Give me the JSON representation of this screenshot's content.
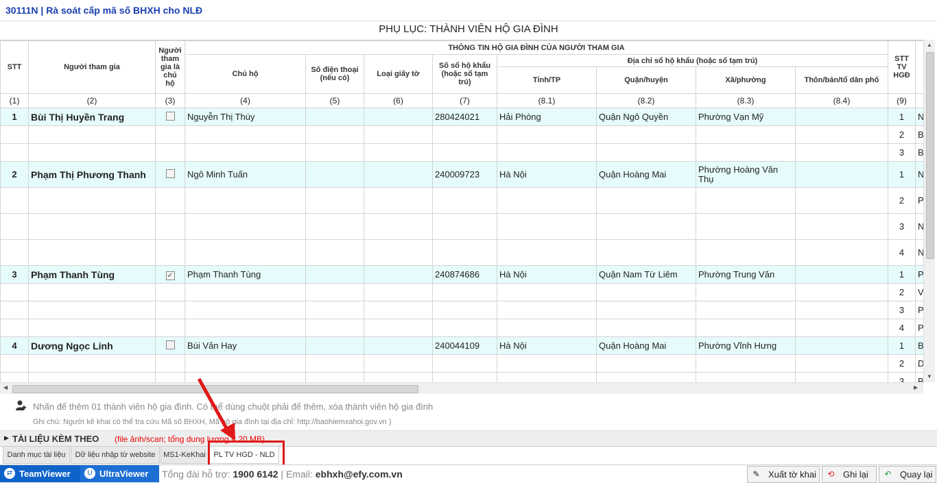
{
  "app_title": "30111N | Rà soát cấp mã số BHXH cho NLĐ",
  "annex_title": "PHỤ LỤC: THÀNH VIÊN HỘ GIA ĐÌNH",
  "headers": {
    "stt": "STT",
    "participant": "Người tham gia",
    "is_head": "Người tham gia là chủ hộ",
    "household_group": "THÔNG TIN HỘ GIA ĐÌNH CỦA NGƯỜI THAM GIA",
    "head_name": "Chủ hộ",
    "phone": "Số điện thoại (nếu có)",
    "doc_type": "Loại giấy tờ",
    "book_no": "Số sổ hộ khẩu (hoặc sổ tạm trú)",
    "address_group": "Địa chỉ sổ hộ khẩu (hoặc sổ tạm trú)",
    "province": "Tỉnh/TP",
    "district": "Quận/huyện",
    "ward": "Xã/phường",
    "hamlet": "Thôn/bản/tổ dân phố",
    "member_stt": "STT TV HGĐ"
  },
  "column_numbers": [
    "(1)",
    "(2)",
    "(3)",
    "(4)",
    "(5)",
    "(6)",
    "(7)",
    "(8.1)",
    "(8.2)",
    "(8.3)",
    "(8.4)",
    "(9)"
  ],
  "rows": [
    {
      "stt": "1",
      "name": "Bùi Thị Huyền Trang",
      "is_head": false,
      "head": "Nguyễn Thị Thúy",
      "book": "280424021",
      "province": "Hải Phòng",
      "district": "Quận Ngô Quyền",
      "ward": "Phường Vạn Mỹ",
      "members": [
        {
          "n": "1",
          "c": "N"
        },
        {
          "n": "2",
          "c": "B"
        },
        {
          "n": "3",
          "c": "B"
        }
      ],
      "tall": false
    },
    {
      "stt": "2",
      "name": "Phạm Thị Phương Thanh",
      "is_head": false,
      "head": "Ngô Minh Tuấn",
      "book": "240009723",
      "province": "Hà Nội",
      "district": "Quận Hoàng Mai",
      "ward": "Phường Hoàng Văn Thụ",
      "members": [
        {
          "n": "1",
          "c": "N"
        },
        {
          "n": "2",
          "c": "P"
        },
        {
          "n": "3",
          "c": "N"
        },
        {
          "n": "4",
          "c": "N"
        }
      ],
      "tall": true
    },
    {
      "stt": "3",
      "name": "Phạm Thanh Tùng",
      "is_head": true,
      "head": "Phạm Thanh Tùng",
      "book": "240874686",
      "province": "Hà Nội",
      "district": "Quận Nam Từ Liêm",
      "ward": "Phường Trung Văn",
      "members": [
        {
          "n": "1",
          "c": "P"
        },
        {
          "n": "2",
          "c": "V"
        },
        {
          "n": "3",
          "c": "P"
        },
        {
          "n": "4",
          "c": "P"
        }
      ],
      "tall": false
    },
    {
      "stt": "4",
      "name": "Dương Ngọc Linh",
      "is_head": false,
      "head": "Bùi Văn Hay",
      "book": "240044109",
      "province": "Hà Nội",
      "district": "Quận Hoàng Mai",
      "ward": "Phường Vĩnh Hưng",
      "members": [
        {
          "n": "1",
          "c": "B"
        },
        {
          "n": "2",
          "c": "D"
        },
        {
          "n": "3",
          "c": "B"
        }
      ],
      "tall": false
    }
  ],
  "add_member_text": "Nhấn để thêm 01 thành viên hộ gia đình. Có thể dùng chuột phải để thêm, xóa thành viên hộ gia đình",
  "note_text": "Ghi chú: Người kê khai có thể tra cứu Mã số BHXH, Mã hộ gia đình tại địa chỉ: http://baohiemxahoi.gov.vn )",
  "attachments_title": "TÀI LIỆU KÈM THEO",
  "attachments_note": "(file ảnh/scan; tổng dung lượng < 20 MB)",
  "tabs": [
    "Danh mục tài liệu",
    "Dữ liệu nhập từ website",
    "MS1-KeKhai",
    "PL TV HGD - NLD"
  ],
  "footer": {
    "teamviewer": "TeamViewer",
    "ultraviewer": "UltraViewer",
    "hotline_label": "Tổng đài hỗ trợ:",
    "hotline": "1900 6142",
    "email_label": "Email:",
    "email": "ebhxh@efy.com.vn",
    "export_btn": "Xuất tờ khai",
    "save_btn": "Ghi lại",
    "back_btn": "Quay lại"
  }
}
